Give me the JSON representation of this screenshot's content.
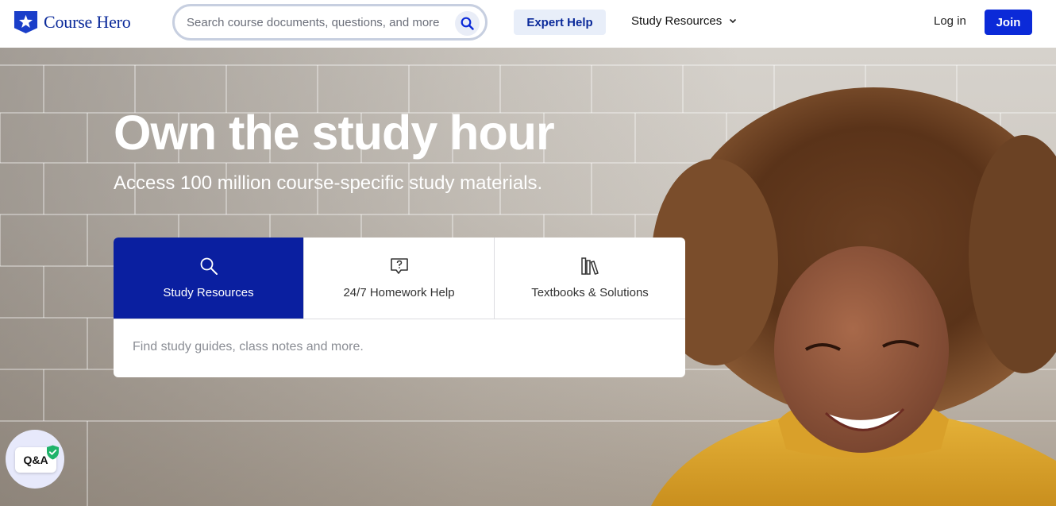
{
  "header": {
    "logo_text": "Course Hero",
    "search_placeholder": "Search course documents, questions, and more",
    "expert_help_label": "Expert Help",
    "study_resources_label": "Study Resources",
    "login_label": "Log in",
    "join_label": "Join"
  },
  "hero": {
    "headline": "Own the study hour",
    "subhead": "Access 100 million course-specific study materials."
  },
  "search_card": {
    "tabs": [
      {
        "label": "Study Resources",
        "icon": "search-icon",
        "active": true
      },
      {
        "label": "24/7 Homework Help",
        "icon": "question-bubble-icon",
        "active": false
      },
      {
        "label": "Textbooks & Solutions",
        "icon": "books-icon",
        "active": false
      }
    ],
    "input_placeholder": "Find study guides, class notes and more."
  },
  "qa_widget": {
    "label": "Q&A"
  },
  "colors": {
    "brand_blue": "#0b2a9a",
    "join_blue": "#0b2ad8",
    "active_tab": "#0a1fa0",
    "verified_green": "#1fb36b"
  }
}
